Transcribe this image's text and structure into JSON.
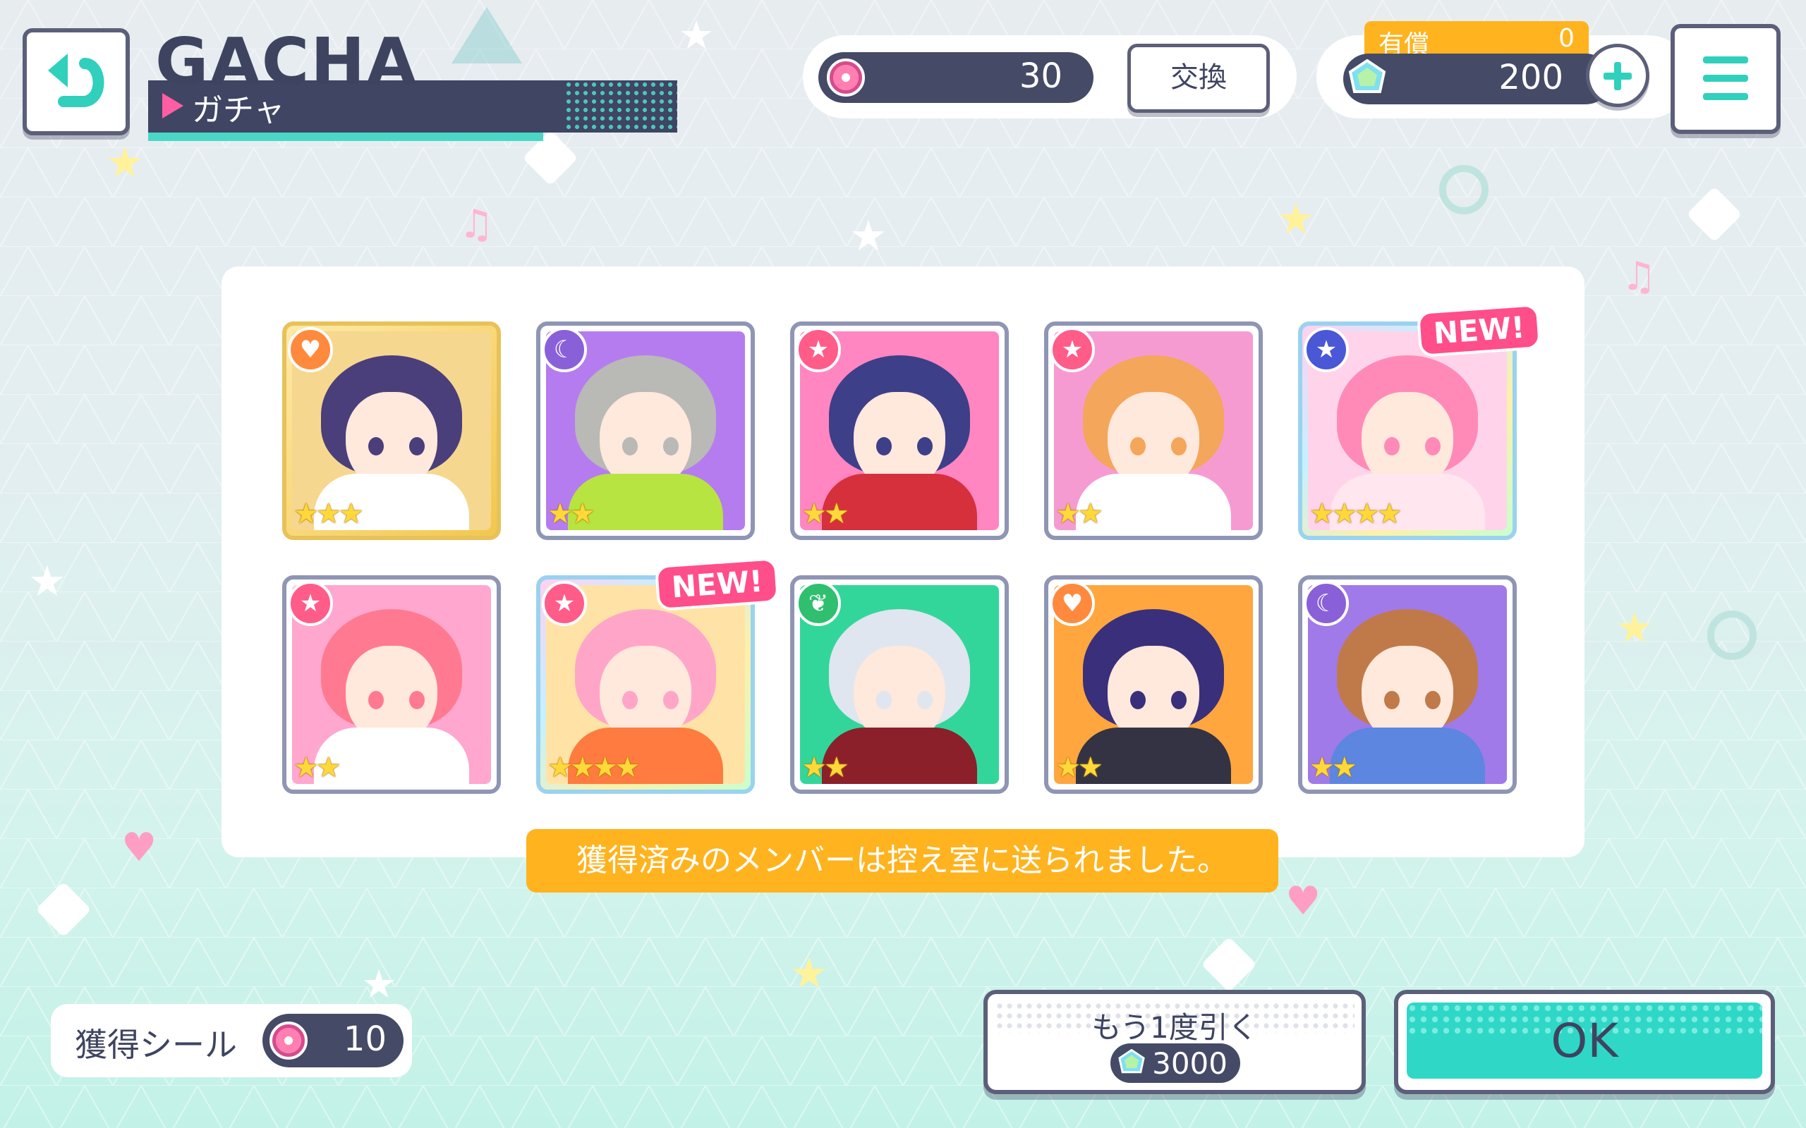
{
  "header": {
    "title": "GACHA",
    "subtitle": "ガチャ"
  },
  "currency": {
    "coins": "30",
    "exchange_label": "交換",
    "paid_label": "有償",
    "paid_value": "0",
    "gems": "200"
  },
  "cards": [
    {
      "attribute": "heart",
      "attr_color": "#ff8a3d",
      "rarity": 3,
      "frame": "gold",
      "new": false,
      "bg": "#f6d78f",
      "hair": "#4a3f7a",
      "outfit": "#ffffff"
    },
    {
      "attribute": "moon",
      "attr_color": "#8a60d9",
      "rarity": 2,
      "frame": "normal",
      "new": false,
      "bg": "#b57cf0",
      "hair": "#b9b9b6",
      "outfit": "#b7e440"
    },
    {
      "attribute": "star",
      "attr_color": "#ff5c8a",
      "rarity": 2,
      "frame": "normal",
      "new": false,
      "bg": "#ff86c0",
      "hair": "#3d3f88",
      "outfit": "#d6303d"
    },
    {
      "attribute": "star",
      "attr_color": "#ff5c8a",
      "rarity": 2,
      "frame": "normal",
      "new": false,
      "bg": "#f69bd2",
      "hair": "#f4a65a",
      "outfit": "#ffffff"
    },
    {
      "attribute": "star",
      "attr_color": "#4a57d6",
      "rarity": 4,
      "frame": "rainbow",
      "new": true,
      "bg": "#ffd4ea",
      "hair": "#ff8ab8",
      "outfit": "#ffe6ef"
    },
    {
      "attribute": "star",
      "attr_color": "#ff5c8a",
      "rarity": 2,
      "frame": "normal",
      "new": false,
      "bg": "#ffa7cf",
      "hair": "#ff7a90",
      "outfit": "#ffffff"
    },
    {
      "attribute": "star",
      "attr_color": "#ff5c8a",
      "rarity": 4,
      "frame": "rainbow",
      "new": true,
      "bg": "#ffe3a6",
      "hair": "#ffa6c8",
      "outfit": "#ff7b3f"
    },
    {
      "attribute": "leaf",
      "attr_color": "#2fbf6f",
      "rarity": 2,
      "frame": "normal",
      "new": false,
      "bg": "#33d69a",
      "hair": "#dfe6ef",
      "outfit": "#8b1f2a"
    },
    {
      "attribute": "heart",
      "attr_color": "#ff8a3d",
      "rarity": 2,
      "frame": "normal",
      "new": false,
      "bg": "#ffa63f",
      "hair": "#3a2f7a",
      "outfit": "#333344"
    },
    {
      "attribute": "moon",
      "attr_color": "#8a60d9",
      "rarity": 2,
      "frame": "normal",
      "new": false,
      "bg": "#a07ae8",
      "hair": "#c07a4a",
      "outfit": "#5c86e0"
    }
  ],
  "new_badge": "NEW!",
  "notice": "獲得済みのメンバーは控え室に送られました。",
  "seal": {
    "label": "獲得シール",
    "value": "10"
  },
  "again": {
    "label": "もう1度引く",
    "cost": "3000"
  },
  "ok_label": "OK"
}
